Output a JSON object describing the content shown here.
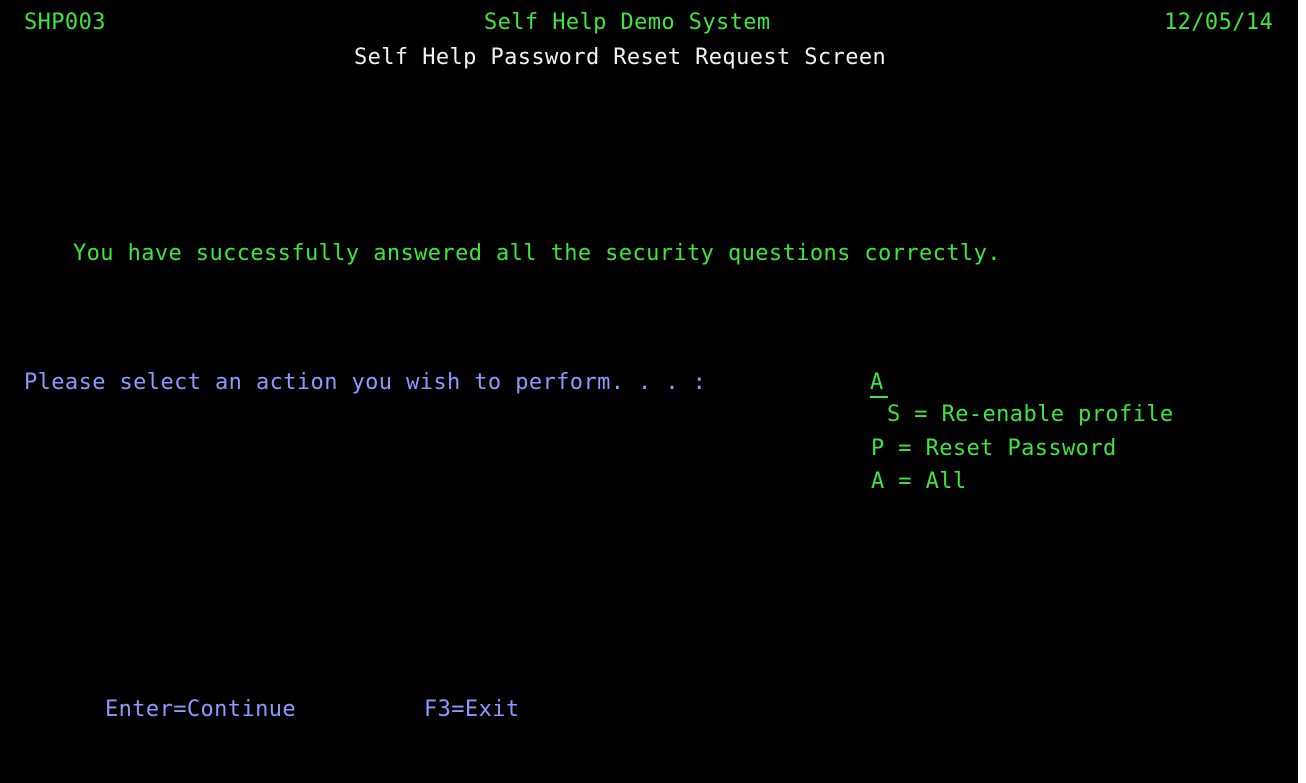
{
  "header": {
    "program_id": "SHP003",
    "system_title": "Self Help Demo System",
    "date": "12/05/14",
    "screen_title": "Self Help Password Reset Request Screen"
  },
  "main": {
    "success_message": "You have successfully answered all the security questions correctly.",
    "action_prompt": "Please select an action you wish to perform. . . :",
    "action_value": "A",
    "options": [
      {
        "label": "S = Re-enable profile"
      },
      {
        "label": "P = Reset Password"
      },
      {
        "label": "A = All"
      }
    ]
  },
  "footer": {
    "function_keys": [
      {
        "label": "Enter=Continue"
      },
      {
        "label": "F3=Exit"
      }
    ]
  },
  "colors": {
    "background": "#000000",
    "green": "#3fe53f",
    "white": "#f2f2f2",
    "blue": "#8a9bff"
  }
}
